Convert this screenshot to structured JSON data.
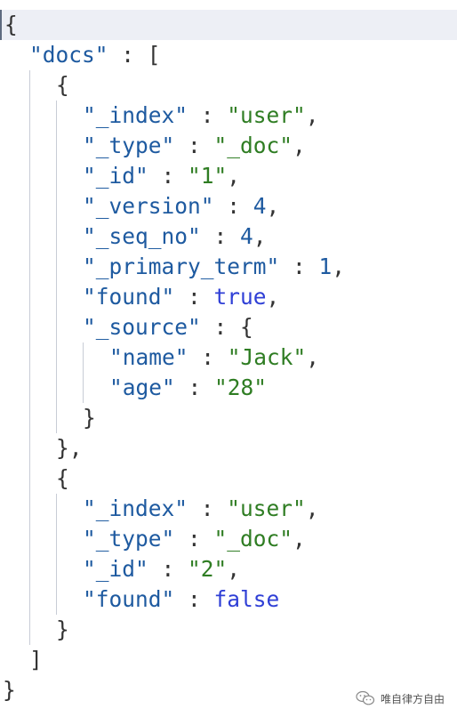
{
  "editor": {
    "lines": [
      {
        "depth": 0,
        "tokens": [
          {
            "t": "punc",
            "v": "{"
          }
        ]
      },
      {
        "depth": 1,
        "tokens": [
          {
            "t": "key",
            "v": "\"docs\""
          },
          {
            "t": "punc",
            "v": " : ["
          }
        ]
      },
      {
        "depth": 2,
        "tokens": [
          {
            "t": "punc",
            "v": "{"
          }
        ]
      },
      {
        "depth": 3,
        "tokens": [
          {
            "t": "key",
            "v": "\"_index\""
          },
          {
            "t": "punc",
            "v": " : "
          },
          {
            "t": "str",
            "v": "\"user\""
          },
          {
            "t": "punc",
            "v": ","
          }
        ]
      },
      {
        "depth": 3,
        "tokens": [
          {
            "t": "key",
            "v": "\"_type\""
          },
          {
            "t": "punc",
            "v": " : "
          },
          {
            "t": "str",
            "v": "\"_doc\""
          },
          {
            "t": "punc",
            "v": ","
          }
        ]
      },
      {
        "depth": 3,
        "tokens": [
          {
            "t": "key",
            "v": "\"_id\""
          },
          {
            "t": "punc",
            "v": " : "
          },
          {
            "t": "str",
            "v": "\"1\""
          },
          {
            "t": "punc",
            "v": ","
          }
        ]
      },
      {
        "depth": 3,
        "tokens": [
          {
            "t": "key",
            "v": "\"_version\""
          },
          {
            "t": "punc",
            "v": " : "
          },
          {
            "t": "num",
            "v": "4"
          },
          {
            "t": "punc",
            "v": ","
          }
        ]
      },
      {
        "depth": 3,
        "tokens": [
          {
            "t": "key",
            "v": "\"_seq_no\""
          },
          {
            "t": "punc",
            "v": " : "
          },
          {
            "t": "num",
            "v": "4"
          },
          {
            "t": "punc",
            "v": ","
          }
        ]
      },
      {
        "depth": 3,
        "tokens": [
          {
            "t": "key",
            "v": "\"_primary_term\""
          },
          {
            "t": "punc",
            "v": " : "
          },
          {
            "t": "num",
            "v": "1"
          },
          {
            "t": "punc",
            "v": ","
          }
        ]
      },
      {
        "depth": 3,
        "tokens": [
          {
            "t": "key",
            "v": "\"found\""
          },
          {
            "t": "punc",
            "v": " : "
          },
          {
            "t": "kw",
            "v": "true"
          },
          {
            "t": "punc",
            "v": ","
          }
        ]
      },
      {
        "depth": 3,
        "tokens": [
          {
            "t": "key",
            "v": "\"_source\""
          },
          {
            "t": "punc",
            "v": " : {"
          }
        ]
      },
      {
        "depth": 4,
        "tokens": [
          {
            "t": "key",
            "v": "\"name\""
          },
          {
            "t": "punc",
            "v": " : "
          },
          {
            "t": "str",
            "v": "\"Jack\""
          },
          {
            "t": "punc",
            "v": ","
          }
        ]
      },
      {
        "depth": 4,
        "tokens": [
          {
            "t": "key",
            "v": "\"age\""
          },
          {
            "t": "punc",
            "v": " : "
          },
          {
            "t": "str",
            "v": "\"28\""
          }
        ]
      },
      {
        "depth": 3,
        "tokens": [
          {
            "t": "punc",
            "v": "}"
          }
        ]
      },
      {
        "depth": 2,
        "tokens": [
          {
            "t": "punc",
            "v": "},"
          }
        ]
      },
      {
        "depth": 2,
        "tokens": [
          {
            "t": "punc",
            "v": "{"
          }
        ]
      },
      {
        "depth": 3,
        "tokens": [
          {
            "t": "key",
            "v": "\"_index\""
          },
          {
            "t": "punc",
            "v": " : "
          },
          {
            "t": "str",
            "v": "\"user\""
          },
          {
            "t": "punc",
            "v": ","
          }
        ]
      },
      {
        "depth": 3,
        "tokens": [
          {
            "t": "key",
            "v": "\"_type\""
          },
          {
            "t": "punc",
            "v": " : "
          },
          {
            "t": "str",
            "v": "\"_doc\""
          },
          {
            "t": "punc",
            "v": ","
          }
        ]
      },
      {
        "depth": 3,
        "tokens": [
          {
            "t": "key",
            "v": "\"_id\""
          },
          {
            "t": "punc",
            "v": " : "
          },
          {
            "t": "str",
            "v": "\"2\""
          },
          {
            "t": "punc",
            "v": ","
          }
        ]
      },
      {
        "depth": 3,
        "tokens": [
          {
            "t": "key",
            "v": "\"found\""
          },
          {
            "t": "punc",
            "v": " : "
          },
          {
            "t": "kw",
            "v": "false"
          }
        ]
      },
      {
        "depth": 2,
        "tokens": [
          {
            "t": "punc",
            "v": "}"
          }
        ]
      },
      {
        "depth": 1,
        "tokens": [
          {
            "t": "punc",
            "v": "]"
          }
        ]
      },
      {
        "depth": 0,
        "tokens": [
          {
            "t": "punc",
            "v": "}"
          }
        ]
      }
    ]
  },
  "watermark": {
    "icon": "wechat-icon",
    "text": "唯自律方自由"
  },
  "colors": {
    "key": "#1e5aa0",
    "string": "#2f7d23",
    "number": "#1e5aa0",
    "keyword": "#2f3fd6",
    "active_line": "#edeff5"
  }
}
